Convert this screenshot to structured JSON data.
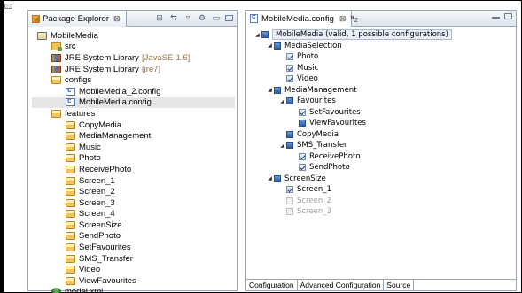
{
  "package_explorer": {
    "tab_label": "Package Explorer",
    "close_glyph": "⊠",
    "tree": [
      {
        "label": "MobileMedia",
        "icon": "project-icon",
        "indent": 0
      },
      {
        "label": "src",
        "icon": "source-folder-icon",
        "indent": 1
      },
      {
        "label": "JRE System Library",
        "suffix": "[JavaSE-1.6]",
        "icon": "library-icon",
        "indent": 1
      },
      {
        "label": "JRE System Library",
        "suffix": "[jre7]",
        "icon": "library-icon",
        "indent": 1
      },
      {
        "label": "configs",
        "icon": "folder-open-icon",
        "indent": 1
      },
      {
        "label": "MobileMedia_2.config",
        "icon": "config-file-icon",
        "indent": 2
      },
      {
        "label": "MobileMedia.config",
        "icon": "config-file-icon",
        "indent": 2,
        "selected": true
      },
      {
        "label": "features",
        "icon": "folder-open-icon",
        "indent": 1
      },
      {
        "label": "CopyMedia",
        "icon": "folder-icon",
        "indent": 2
      },
      {
        "label": "MediaManagement",
        "icon": "folder-icon",
        "indent": 2
      },
      {
        "label": "Music",
        "icon": "folder-icon",
        "indent": 2
      },
      {
        "label": "Photo",
        "icon": "folder-icon",
        "indent": 2
      },
      {
        "label": "ReceivePhoto",
        "icon": "folder-icon",
        "indent": 2
      },
      {
        "label": "Screen_1",
        "icon": "folder-icon",
        "indent": 2
      },
      {
        "label": "Screen_2",
        "icon": "folder-icon",
        "indent": 2
      },
      {
        "label": "Screen_3",
        "icon": "folder-icon",
        "indent": 2
      },
      {
        "label": "Screen_4",
        "icon": "folder-icon",
        "indent": 2
      },
      {
        "label": "ScreenSize",
        "icon": "folder-icon",
        "indent": 2
      },
      {
        "label": "SendPhoto",
        "icon": "folder-icon",
        "indent": 2
      },
      {
        "label": "SetFavourites",
        "icon": "folder-icon",
        "indent": 2
      },
      {
        "label": "SMS_Transfer",
        "icon": "folder-icon",
        "indent": 2
      },
      {
        "label": "Video",
        "icon": "folder-icon",
        "indent": 2
      },
      {
        "label": "ViewFavourites",
        "icon": "folder-icon",
        "indent": 2
      },
      {
        "label": "model.xml",
        "icon": "model-icon",
        "indent": 1
      }
    ]
  },
  "editor": {
    "tab_label": "MobileMedia.config",
    "close_glyph": "⊠",
    "overflow_label": "»",
    "overflow_count": "2",
    "tree": [
      {
        "label": "MobileMedia (valid, 1 possible configurations)",
        "kind": "root",
        "indent": 0,
        "twisty": "◢"
      },
      {
        "label": "MediaSelection",
        "kind": "feature",
        "indent": 1,
        "twisty": "◢"
      },
      {
        "label": "Photo",
        "kind": "checked",
        "indent": 2
      },
      {
        "label": "Music",
        "kind": "checked",
        "indent": 2
      },
      {
        "label": "Video",
        "kind": "checked",
        "indent": 2
      },
      {
        "label": "MediaManagement",
        "kind": "feature",
        "indent": 1,
        "twisty": "◢"
      },
      {
        "label": "Favourites",
        "kind": "feature",
        "indent": 2,
        "twisty": "◢"
      },
      {
        "label": "SetFavourites",
        "kind": "checked",
        "indent": 3
      },
      {
        "label": "ViewFavourites",
        "kind": "feature",
        "indent": 3
      },
      {
        "label": "CopyMedia",
        "kind": "feature",
        "indent": 2
      },
      {
        "label": "SMS_Transfer",
        "kind": "feature",
        "indent": 2,
        "twisty": "◢"
      },
      {
        "label": "ReceivePhoto",
        "kind": "checked",
        "indent": 3
      },
      {
        "label": "SendPhoto",
        "kind": "checked",
        "indent": 3
      },
      {
        "label": "ScreenSize",
        "kind": "feature",
        "indent": 1,
        "twisty": "◢"
      },
      {
        "label": "Screen_1",
        "kind": "checked",
        "indent": 2
      },
      {
        "label": "Screen_2",
        "kind": "disabled",
        "indent": 2
      },
      {
        "label": "Screen_3",
        "kind": "disabled",
        "indent": 2
      }
    ],
    "bottom_tabs": [
      "Configuration",
      "Advanced Configuration",
      "Source"
    ]
  }
}
